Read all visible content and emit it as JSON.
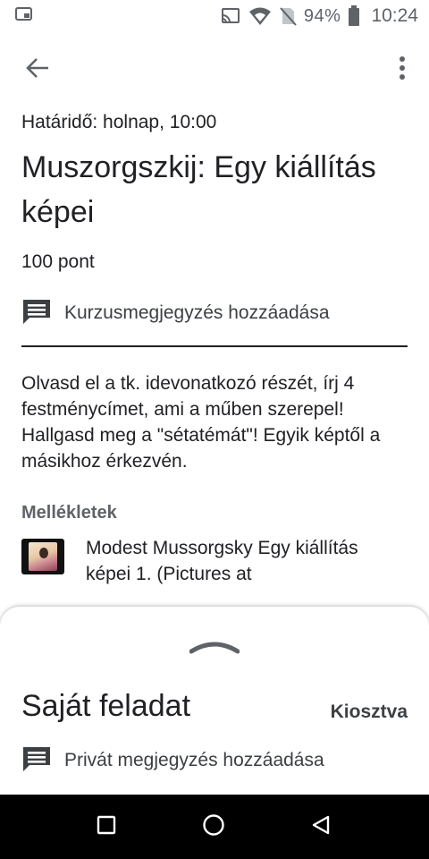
{
  "status_bar": {
    "battery_percent": "94%",
    "time": "10:24",
    "icons": [
      "device-icon",
      "cast-icon",
      "wifi-icon",
      "no-sim-icon",
      "battery-icon"
    ]
  },
  "app_bar": {
    "icons": [
      "back-arrow-icon",
      "more-vert-icon"
    ]
  },
  "assignment": {
    "due": "Határidő: holnap, 10:00",
    "title": "Muszorgszkij: Egy kiállítás képei",
    "points": "100 pont",
    "class_comment_label": "Kurzusmegjegyzés hozzáadása",
    "description": "Olvasd el a tk. idevonatkozó részét, írj 4 festménycímet, ami a műben szerepel! Hallgasd meg a \"sétatémát\"! Egyik képtől a másikhoz érkezvén.",
    "attachments_heading": "Mellékletek",
    "attachments": [
      {
        "title": "Modest Mussorgsky Egy kiállítás képei 1. (Pictures at"
      }
    ]
  },
  "bottom_sheet": {
    "title": "Saját feladat",
    "status": "Kiosztva",
    "private_comment_label": "Privát megjegyzés hozzáadása"
  },
  "nav_bar": {
    "buttons": [
      "recents-square-icon",
      "home-circle-icon",
      "back-triangle-icon"
    ]
  },
  "colors": {
    "text_primary": "#202124",
    "text_secondary": "#5f6368",
    "nav_bar_bg": "#000000"
  }
}
